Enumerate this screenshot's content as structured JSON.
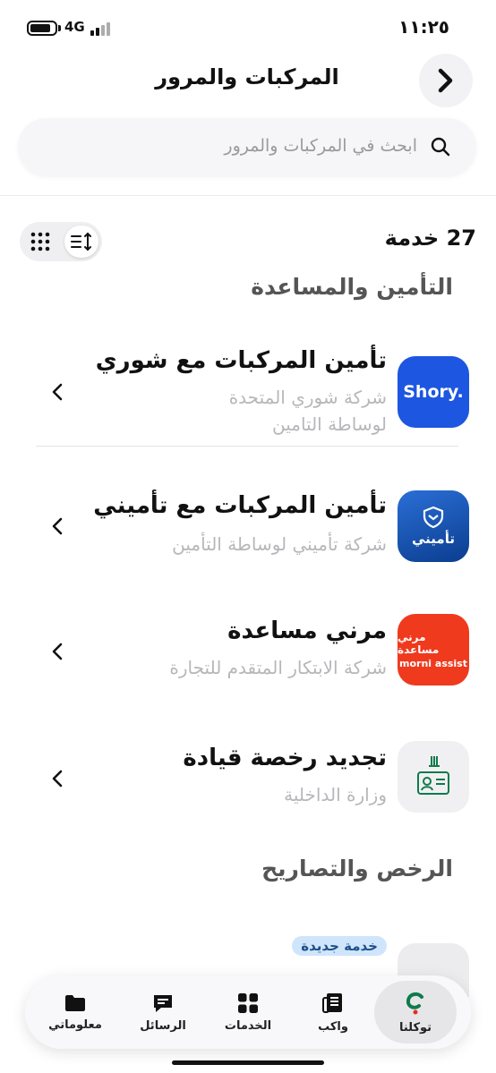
{
  "status_bar": {
    "time": "١١:٢٥",
    "network": "4G"
  },
  "header": {
    "title": "المركبات والمرور",
    "back_icon": "chevron-right-icon"
  },
  "search": {
    "placeholder": "ابحث في المركبات والمرور"
  },
  "controls": {
    "count_label": "27 خدمة",
    "view_options": [
      "sort-icon",
      "grid-icon"
    ]
  },
  "sections": [
    {
      "title": "التأمين والمساعدة"
    },
    {
      "title": "الرخص والتصاريح"
    }
  ],
  "services": [
    {
      "name": "تأمين المركبات مع شوري",
      "provider_line1": "شركة شوري المتحدة",
      "provider_line2": "لوساطة التامين",
      "logo_text": "Shory."
    },
    {
      "name": "تأمين المركبات مع تأميني",
      "provider_line1": "شركة تأميني لوساطة التأمين",
      "logo_text": "تأميني"
    },
    {
      "name": "مرني مساعدة",
      "provider_line1": "شركة الابتكار المتقدم للتجارة",
      "logo_text_ar": "مرني مساعدة",
      "logo_text_en": "morni assist"
    },
    {
      "name": "تجديد رخصة  قيادة",
      "provider_line1": "وزارة الداخلية"
    }
  ],
  "new_badge": "خدمة جديدة",
  "bottom_nav": {
    "tabs": [
      {
        "label": "توكلنا",
        "active": true
      },
      {
        "label": "واكب",
        "active": false
      },
      {
        "label": "الخدمات",
        "active": false
      },
      {
        "label": "الرسائل",
        "active": false
      },
      {
        "label": "معلوماتي",
        "active": false
      }
    ]
  },
  "colors": {
    "shory_blue": "#1d56e0",
    "morni_red": "#ef3a1e",
    "tameeni_blue": "#0b3d8f",
    "badge_bg": "#cfe5fb",
    "tawakkalna_green": "#0f7a4c"
  }
}
